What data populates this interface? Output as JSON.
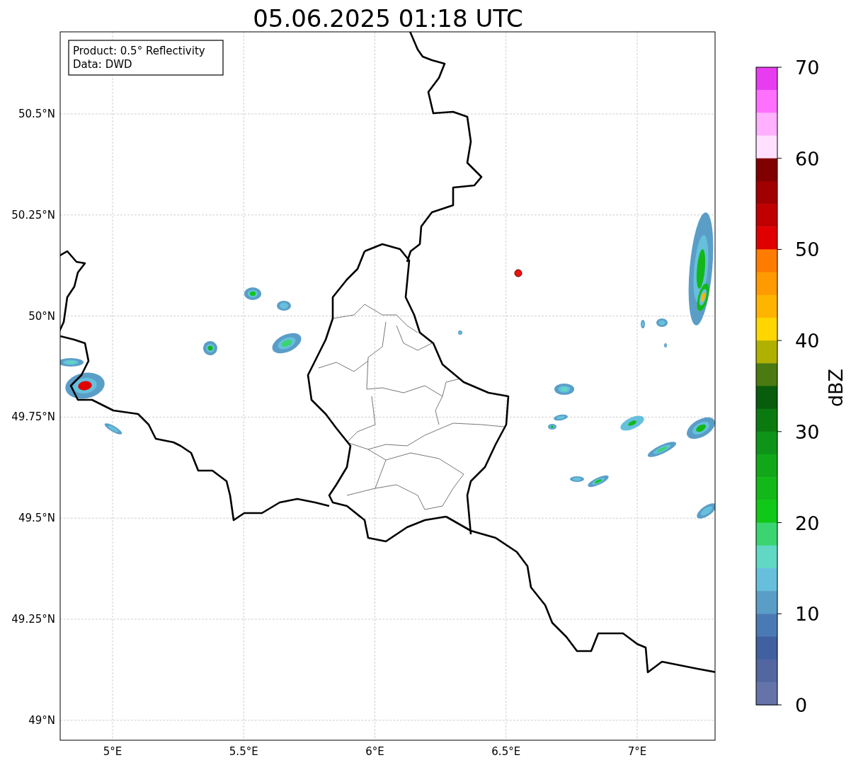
{
  "title": "05.06.2025 01:18 UTC",
  "map": {
    "info_box": [
      "Product: 0.5° Reflectivity",
      "Data: DWD"
    ],
    "x_ticks": [
      "5°E",
      "5.5°E",
      "6°E",
      "6.5°E",
      "7°E"
    ],
    "y_ticks": [
      "50.5°N",
      "50.25°N",
      "50°N",
      "49.75°N",
      "49.5°N",
      "49.25°N",
      "49°N"
    ]
  },
  "colorbar": {
    "label": "dBZ",
    "ticks": [
      "70",
      "60",
      "50",
      "40",
      "30",
      "20",
      "10",
      "0"
    ],
    "bins": [
      {
        "color": "#e83cf0"
      },
      {
        "color": "#ff70ff"
      },
      {
        "color": "#ffb0ff"
      },
      {
        "color": "#ffe0ff"
      },
      {
        "color": "#800000"
      },
      {
        "color": "#a00000"
      },
      {
        "color": "#c00000"
      },
      {
        "color": "#e00000"
      },
      {
        "color": "#ff7c00"
      },
      {
        "color": "#ff9a00"
      },
      {
        "color": "#ffb400"
      },
      {
        "color": "#ffd600"
      },
      {
        "color": "#b0b000"
      },
      {
        "color": "#4a7a10"
      },
      {
        "color": "#085c0c"
      },
      {
        "color": "#0a7a10"
      },
      {
        "color": "#0e9418"
      },
      {
        "color": "#10a818"
      },
      {
        "color": "#12b818"
      },
      {
        "color": "#10c818"
      },
      {
        "color": "#3ad470"
      },
      {
        "color": "#60d8c4"
      },
      {
        "color": "#66c0dc"
      },
      {
        "color": "#5a9ec8"
      },
      {
        "color": "#4a7ab4"
      },
      {
        "color": "#4060a0"
      },
      {
        "color": "#5266a0"
      },
      {
        "color": "#6474a8"
      }
    ]
  }
}
